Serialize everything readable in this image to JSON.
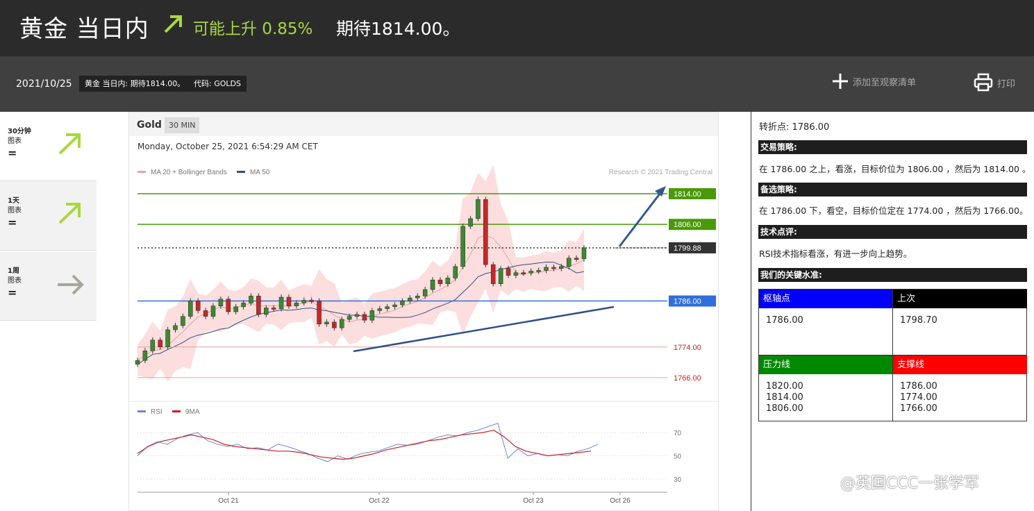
{
  "header": {
    "title": "黄金 当日内",
    "trend_text": "可能上升 0.85%",
    "expect_text": "期待1814.00。"
  },
  "subheader": {
    "date": "2021/10/25",
    "tag_title": "黄金 当日内: 期待1814.00。",
    "tag_code": "代码: GOLDS",
    "add_watchlist": "添加至观察清单",
    "print": "打印"
  },
  "sidebar": {
    "items": [
      {
        "period": "30分钟",
        "label": "图表",
        "status": "=",
        "direction": "up"
      },
      {
        "period": "1天",
        "label": "图表",
        "status": "=",
        "direction": "up"
      },
      {
        "period": "1周",
        "label": "图表",
        "status": "=",
        "direction": "right"
      }
    ]
  },
  "chart": {
    "symbol": "Gold",
    "timeframe": "30 MIN",
    "datetime": "Monday, October 25, 2021 6:54:29 AM CET",
    "legend_bb": "MA 20 + Bollinger Bands",
    "legend_ma": "MA 50",
    "credit": "Research © 2021 Trading Central",
    "rsi_legend": "RSI",
    "rsi_ma_legend": "9MA"
  },
  "chart_data": {
    "type": "candlestick",
    "x_tick_labels": [
      "Oct 21",
      "Oct 22",
      "Oct 23",
      "Oct 26"
    ],
    "y_range": [
      1762,
      1816
    ],
    "price_levels": [
      {
        "label": "1814.00",
        "value": 1814.0,
        "kind": "resistance",
        "color": "#4a9a07"
      },
      {
        "label": "1806.00",
        "value": 1806.0,
        "kind": "resistance",
        "color": "#4a9a07"
      },
      {
        "label": "1799.88",
        "value": 1799.88,
        "kind": "last",
        "color": "#333333"
      },
      {
        "label": "1786.00",
        "value": 1786.0,
        "kind": "pivot",
        "color": "#2f6fdb"
      },
      {
        "label": "1774.00",
        "value": 1774.0,
        "kind": "support",
        "color": "#e8a0a0"
      },
      {
        "label": "1766.00",
        "value": 1766.0,
        "kind": "support",
        "color": "#e8a0a0"
      }
    ],
    "close_series": [
      1770.5,
      1773.0,
      1775.8,
      1774.0,
      1778.5,
      1779.6,
      1782.0,
      1786.0,
      1783.5,
      1782.0,
      1784.7,
      1786.5,
      1783.2,
      1784.5,
      1785.5,
      1787.3,
      1782.5,
      1784.2,
      1784.0,
      1787.0,
      1784.7,
      1785.5,
      1786.2,
      1786.0,
      1780.0,
      1780.5,
      1779.0,
      1781.2,
      1782.0,
      1782.5,
      1781.0,
      1783.5,
      1784.0,
      1784.5,
      1785.0,
      1786.0,
      1786.8,
      1787.3,
      1789.0,
      1791.5,
      1790.5,
      1792.0,
      1795.0,
      1805.5,
      1807.5,
      1812.5,
      1795.5,
      1790.5,
      1794.5,
      1792.7,
      1793.4,
      1793.3,
      1793.8,
      1794.0,
      1794.8,
      1794.5,
      1795.0,
      1797.2,
      1797.0,
      1799.88
    ],
    "rsi": {
      "name": "RSI",
      "y_ticks": [
        70,
        50,
        30
      ],
      "values": [
        50,
        58,
        62,
        60,
        65,
        68,
        70,
        63,
        60,
        58,
        60,
        56,
        57,
        55,
        60,
        58,
        55,
        52,
        48,
        45,
        50,
        47,
        51,
        53,
        54,
        57,
        60,
        59,
        60,
        63,
        66,
        68,
        67,
        70,
        72,
        75,
        78,
        48,
        56,
        50,
        52,
        50,
        51,
        50,
        54,
        56,
        60
      ]
    },
    "rsi_ma": {
      "name": "9MA",
      "values": [
        52,
        58,
        62,
        64,
        66,
        68,
        66,
        64,
        60,
        58,
        57,
        56,
        55,
        54,
        54,
        53,
        51,
        49,
        48,
        47,
        48,
        50,
        52,
        55,
        57,
        59,
        61,
        63,
        64,
        66,
        68,
        69,
        70,
        72,
        66,
        58,
        54,
        52,
        50,
        51,
        52,
        53,
        54
      ]
    }
  },
  "analysis": {
    "pivot_line": "转折点: 1786.00",
    "strategy_title": "交易策略:",
    "strategy_text": "在 1786.00 之上，看涨，目标价位为 1806.00 ，然后为 1814.00 。",
    "alt_title": "备选策略:",
    "alt_text": "在 1786.00 下，看空，目标价位定在 1774.00 ，然后为 1766.00。",
    "tech_title": "技术点评:",
    "tech_text": "RSI技术指标看涨，有进一步向上趋势。",
    "levels_title": "我们的关键水准:",
    "pivot_head": "枢轴点",
    "pivot_val": "1786.00",
    "last_head": "上次",
    "last_val": "1798.70",
    "res_head": "压力线",
    "res_vals": "1820.00\n1814.00\n1806.00",
    "sup_head": "支撑线",
    "sup_vals": "1786.00\n1774.00\n1766.00",
    "colors": {
      "pivot": "#0000ff",
      "last": "#000000",
      "res": "#008800",
      "sup": "#ff0000"
    }
  },
  "watermark": "@英国CCC一张学军"
}
